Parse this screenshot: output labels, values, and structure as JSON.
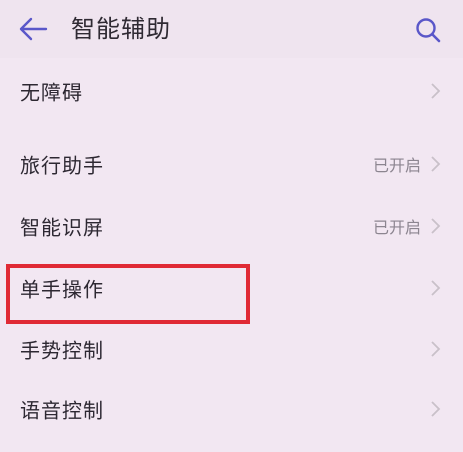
{
  "header": {
    "title": "智能辅助",
    "back_icon": "back-arrow-icon",
    "search_icon": "search-icon"
  },
  "colors": {
    "accent": "#5a57c9",
    "background": "#f2e7f2",
    "highlight": "#e02a35",
    "status_text": "#8c8590"
  },
  "items": [
    {
      "label": "无障碍",
      "status": ""
    },
    {
      "label": "旅行助手",
      "status": "已开启"
    },
    {
      "label": "智能识屏",
      "status": "已开启"
    },
    {
      "label": "单手操作",
      "status": ""
    },
    {
      "label": "手势控制",
      "status": ""
    },
    {
      "label": "语音控制",
      "status": ""
    }
  ]
}
